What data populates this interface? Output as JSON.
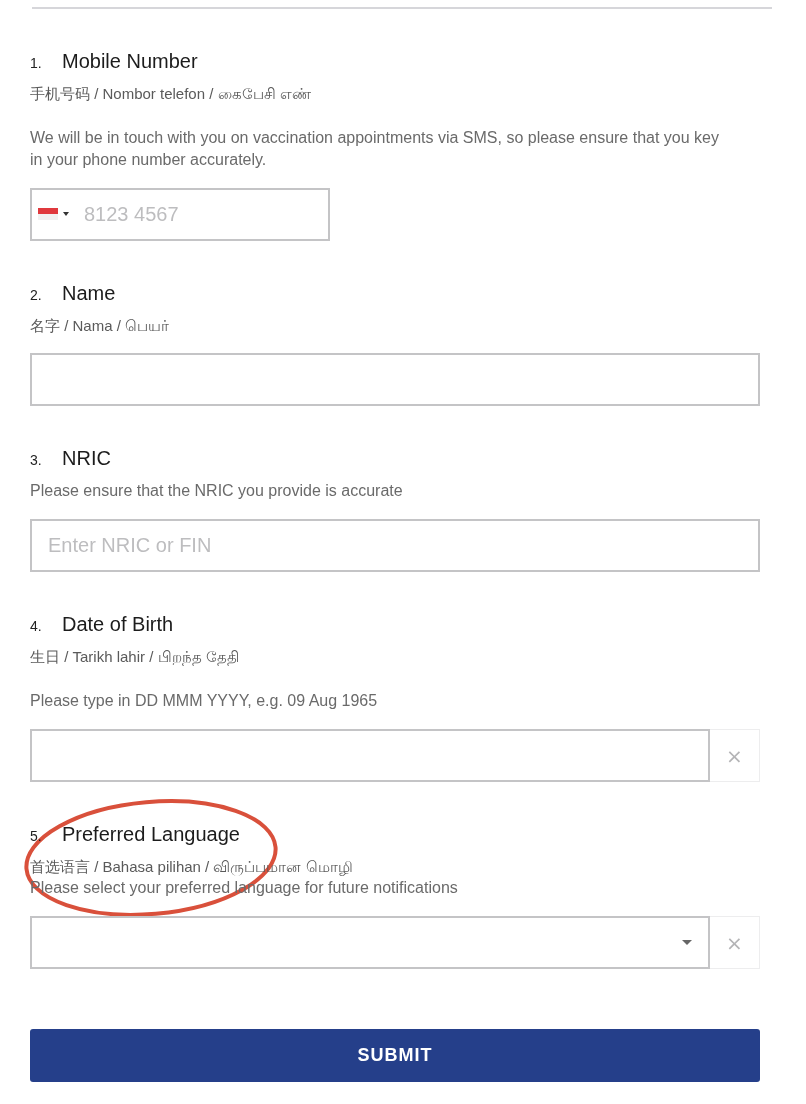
{
  "questions": [
    {
      "number": "1.",
      "title": "Mobile Number",
      "subtitle": "手机号码 / Nombor telefon / கைபேசி எண்",
      "description": "We will be in touch with you on vaccination appointments via SMS, so please ensure that you key in your phone number accurately.",
      "field": {
        "kind": "phone",
        "placeholder": "8123 4567"
      },
      "highlighted": false
    },
    {
      "number": "2.",
      "title": "Name",
      "subtitle": "名字 / Nama / பெயர்",
      "field": {
        "kind": "text"
      },
      "highlighted": false
    },
    {
      "number": "3.",
      "title": "NRIC",
      "hint": "Please ensure that the NRIC you provide is accurate",
      "field": {
        "kind": "text",
        "placeholder": "Enter NRIC or FIN"
      },
      "highlighted": false
    },
    {
      "number": "4.",
      "title": "Date of Birth",
      "subtitle": "生日 / Tarikh lahir / பிறந்த தேதி",
      "description": "Please type in DD MMM YYYY, e.g. 09 Aug 1965",
      "field": {
        "kind": "date",
        "clear_label": "×"
      },
      "highlighted": false
    },
    {
      "number": "5.",
      "title": "Preferred Language",
      "subtitle": "首选语言 / Bahasa pilihan / விருப்பமான மொழி",
      "hint": "Please select your preferred language for future notifications",
      "field": {
        "kind": "select",
        "clear_label": "×"
      },
      "highlighted": true
    }
  ],
  "submit_button": "SUBMIT"
}
